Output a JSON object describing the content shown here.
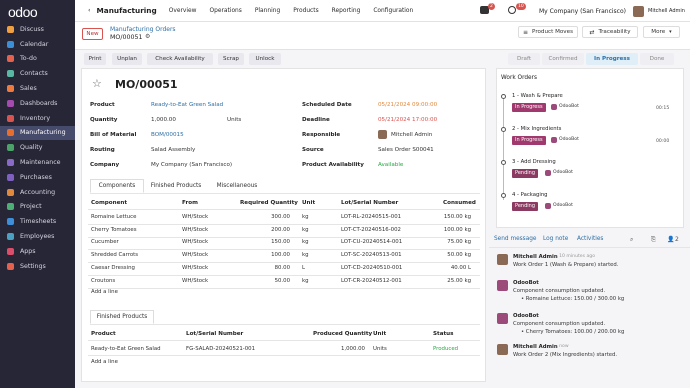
{
  "logo": "odoo",
  "sidebar": {
    "items": [
      {
        "label": "Discuss",
        "color": "#f0a040"
      },
      {
        "label": "Calendar",
        "color": "#3b8fd6"
      },
      {
        "label": "To-do",
        "color": "#e3614d"
      },
      {
        "label": "Contacts",
        "color": "#5ab7a4"
      },
      {
        "label": "Sales",
        "color": "#f07a3d"
      },
      {
        "label": "Dashboards",
        "color": "#a44bb0"
      },
      {
        "label": "Inventory",
        "color": "#d9534f"
      },
      {
        "label": "Manufacturing",
        "color": "#e86e2e"
      },
      {
        "label": "Quality",
        "color": "#4ca36a"
      },
      {
        "label": "Maintenance",
        "color": "#8a6ac9"
      },
      {
        "label": "Purchases",
        "color": "#7e60c0"
      },
      {
        "label": "Accounting",
        "color": "#e0883c"
      },
      {
        "label": "Project",
        "color": "#4caf73"
      },
      {
        "label": "Timesheets",
        "color": "#3f8ed8"
      },
      {
        "label": "Employees",
        "color": "#4aa1c3"
      },
      {
        "label": "Apps",
        "color": "#d94e6b"
      },
      {
        "label": "Settings",
        "color": "#e3614d"
      }
    ]
  },
  "topbar": {
    "back": "‹",
    "app": "Manufacturing",
    "menus": [
      "Overview",
      "Operations",
      "Planning",
      "Products",
      "Reporting",
      "Configuration"
    ],
    "msg_count": "2",
    "activity_count": "10",
    "company": "My Company (San Francisco)",
    "user": "Mitchell Admin"
  },
  "control": {
    "new": "New",
    "breadcrumb": "Manufacturing Orders",
    "record": "MO/00051",
    "gear": "⚙",
    "product_moves": "Product Moves",
    "traceability": "Traceability",
    "more": "More"
  },
  "actions": [
    "Print",
    "Unplan",
    "Check Availability",
    "Scrap",
    "Unlock"
  ],
  "stages": [
    "Draft",
    "Confirmed",
    "In Progress",
    "Done"
  ],
  "form": {
    "title": "MO/00051",
    "star": "☆",
    "left": [
      {
        "label": "Product",
        "value": "Ready-to-Eat Green Salad",
        "link": true
      },
      {
        "label": "Quantity",
        "value": "1,000.00",
        "unit": "Units"
      },
      {
        "label": "Bill of Material",
        "value": "BOM/00015",
        "link": true
      },
      {
        "label": "Routing",
        "value": "Salad Assembly"
      },
      {
        "label": "Company",
        "value": "My Company (San Francisco)"
      }
    ],
    "right": [
      {
        "label": "Scheduled Date",
        "value": "05/21/2024 09:00:00",
        "orange": true
      },
      {
        "label": "Deadline",
        "value": "05/21/2024 17:00:00",
        "red": true
      },
      {
        "label": "Responsible",
        "value": "Mitchell Admin"
      },
      {
        "label": "Source",
        "value": "Sales Order S00041"
      },
      {
        "label": "Product Availability",
        "value": "Available",
        "green": true
      }
    ]
  },
  "tabs": [
    "Components",
    "Finished Products",
    "Miscellaneous"
  ],
  "comp": {
    "headers": [
      "Component",
      "From",
      "Required Quantity",
      "Unit",
      "Lot/Serial Number",
      "Consumed"
    ],
    "rows": [
      [
        "Romaine Lettuce",
        "WH/Stock",
        "300.00",
        "kg",
        "LOT-RL-20240515-001",
        "150.00 kg"
      ],
      [
        "Cherry Tomatoes",
        "WH/Stock",
        "200.00",
        "kg",
        "LOT-CT-20240516-002",
        "100.00 kg"
      ],
      [
        "Cucumber",
        "WH/Stock",
        "150.00",
        "kg",
        "LOT-CU-20240514-001",
        "75.00 kg"
      ],
      [
        "Shredded Carrots",
        "WH/Stock",
        "100.00",
        "kg",
        "LOT-SC-20240513-001",
        "50.00 kg"
      ],
      [
        "Caesar Dressing",
        "WH/Stock",
        "80.00",
        "L",
        "LOT-CD-20240510-001",
        "40.00 L"
      ],
      [
        "Croutons",
        "WH/Stock",
        "50.00",
        "kg",
        "LOT-CR-20240512-001",
        "25.00 kg"
      ]
    ],
    "add": "Add a line"
  },
  "fin": {
    "tab": "Finished Products",
    "headers": [
      "Product",
      "Lot/Serial Number",
      "Produced Quantity",
      "Unit",
      "Status"
    ],
    "rows": [
      [
        "Ready-to-Eat Green Salad",
        "FG-SALAD-20240521-001",
        "1,000.00",
        "Units",
        "Produced"
      ]
    ],
    "add": "Add a line"
  },
  "workorders": {
    "title": "Work Orders",
    "items": [
      {
        "name": "1 - Wash & Prepare",
        "status": "In Progress",
        "color": "#a03a6e",
        "worker": "OdooBot",
        "time": "00:15"
      },
      {
        "name": "2 - Mix Ingredients",
        "status": "In Progress",
        "color": "#a03a6e",
        "worker": "OdooBot",
        "time": "00:00"
      },
      {
        "name": "3 - Add Dressing",
        "status": "Pending",
        "color": "#8b3a62",
        "worker": "OdooBot",
        "time": ""
      },
      {
        "name": "4 - Packaging",
        "status": "Pending",
        "color": "#8b3a62",
        "worker": "OdooBot",
        "time": ""
      }
    ]
  },
  "chatter": {
    "send": "Send message",
    "log": "Log note",
    "activities": "Activities",
    "followers": "2",
    "messages": [
      {
        "author": "Mitchell Admin",
        "ago": "- 10 minutes ago",
        "lines": [
          "Work Order 1 (Wash & Prepare) started."
        ]
      },
      {
        "author": "OdooBot",
        "ago": "",
        "lines": [
          "Component consumption updated.",
          "• Romaine Lettuce: 150.00 / 300.00 kg"
        ]
      },
      {
        "author": "OdooBot",
        "ago": "",
        "lines": [
          "Component consumption updated.",
          "• Cherry Tomatoes: 100.00 / 200.00 kg"
        ]
      },
      {
        "author": "Mitchell Admin",
        "ago": "- now",
        "lines": [
          "Work Order 2 (Mix Ingredients) started."
        ]
      }
    ]
  }
}
